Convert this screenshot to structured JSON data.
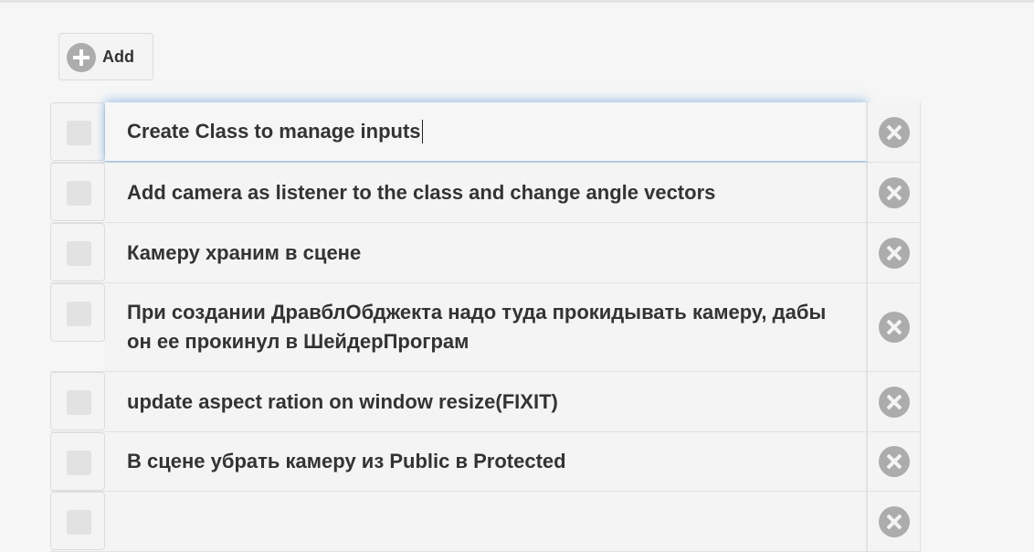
{
  "toolbar": {
    "add_label": "Add",
    "add_icon": "plus-circle-icon"
  },
  "todos": [
    {
      "text": "Create Class to manage inputs",
      "completed": false,
      "editing": true
    },
    {
      "text": "Add camera as listener to the class and change angle vectors",
      "completed": false,
      "editing": false
    },
    {
      "text": "Камеру храним в сцене",
      "completed": false,
      "editing": false
    },
    {
      "text": "При создании ДравблОбджекта надо туда прокидывать камеру, дабы он ее прокинул в ШейдерПрограм",
      "completed": false,
      "editing": false
    },
    {
      "text": "update aspect ration on window resize(FIXIT)",
      "completed": false,
      "editing": false
    },
    {
      "text": "В сцене убрать камеру из Public в Protected",
      "completed": false,
      "editing": false
    },
    {
      "text": "",
      "completed": false,
      "editing": false
    }
  ],
  "icons": {
    "delete": "close-circle-icon"
  },
  "colors": {
    "background": "#f6f6f6",
    "icon_gray": "#acacac",
    "focus_glow": "#a9c8e6"
  }
}
